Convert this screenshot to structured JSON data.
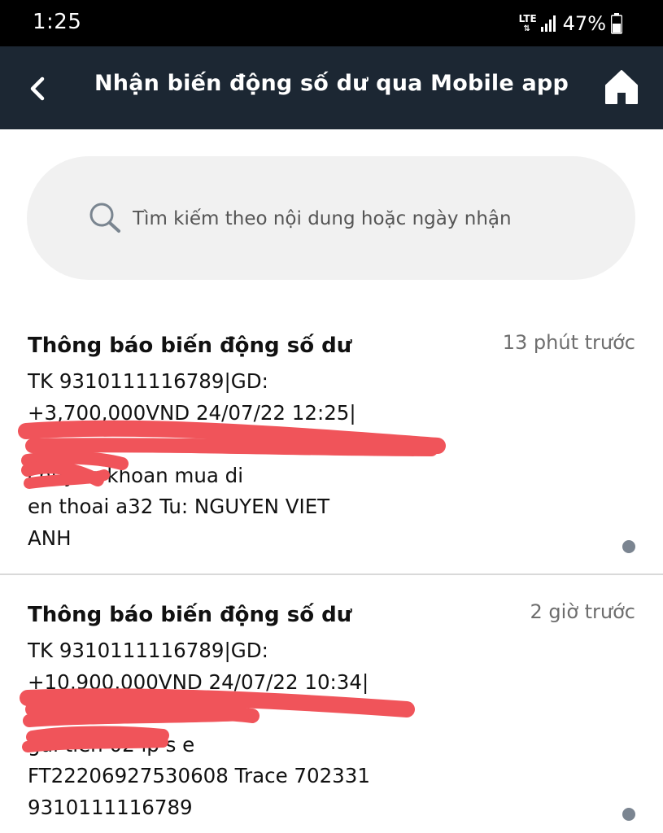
{
  "status_bar": {
    "time": "1:25",
    "network": "LTE",
    "battery": "47%"
  },
  "header": {
    "title": "Nhận biến động số dư qua Mobile app",
    "back_icon": "chevron-left-icon",
    "home_icon": "home-icon",
    "background": "#1c2733"
  },
  "search": {
    "placeholder": "Tìm kiếm theo nội dung hoặc ngày nhận",
    "icon": "search-icon"
  },
  "notifications": [
    {
      "title": "Thông báo biến động số dư",
      "time": "13 phút trước",
      "body": "TK 9310111116789|GD:\n+3,700,000VND 24/07/22 12:25|\n\n                chuyen khoan mua di\nen thoai a32 Tu: NGUYEN VIET\nANH",
      "unread": true
    },
    {
      "title": "Thông báo biến động số dư",
      "time": "2 giờ trước",
      "body": "TK 9310111116789|GD:\n+10,900,000VND 24/07/22 10:34|\n\n                 gui tien 02 ip s e\nFT22206927530608 Trace 702331\n9310111116789",
      "unread": true
    }
  ],
  "colors": {
    "redaction": "#f0545a",
    "unread_dot": "#7b8591"
  }
}
